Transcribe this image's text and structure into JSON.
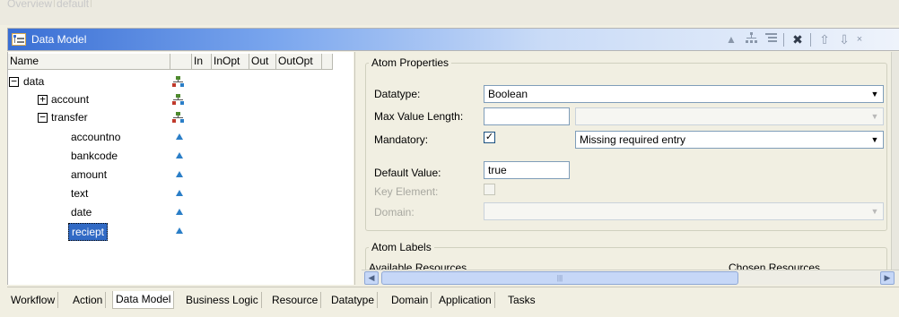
{
  "top_tabs": [
    "Overview",
    "default"
  ],
  "panel": {
    "title": "Data Model"
  },
  "toolbar": {
    "icons": [
      "up-triangle-icon",
      "tree-structure-icon",
      "list-indent-icon",
      "delete-icon",
      "arrow-up-icon",
      "arrow-down-icon",
      "close-icon"
    ]
  },
  "columns": [
    "Name",
    "In",
    "InOpt",
    "Out",
    "OutOpt"
  ],
  "tree": [
    {
      "label": "data",
      "expander": "−",
      "level": 0,
      "icon": "structure-icon"
    },
    {
      "label": "account",
      "expander": "+",
      "level": 1,
      "icon": "structure-icon"
    },
    {
      "label": "transfer",
      "expander": "−",
      "level": 1,
      "icon": "structure-icon"
    },
    {
      "label": "accountno",
      "level": 2,
      "icon": "atom-icon"
    },
    {
      "label": "bankcode",
      "level": 2,
      "icon": "atom-icon"
    },
    {
      "label": "amount",
      "level": 2,
      "icon": "atom-icon"
    },
    {
      "label": "text",
      "level": 2,
      "icon": "atom-icon"
    },
    {
      "label": "date",
      "level": 2,
      "icon": "atom-icon"
    },
    {
      "label": "reciept",
      "level": 2,
      "icon": "atom-icon",
      "selected": true
    }
  ],
  "atom_properties": {
    "title": "Atom Properties",
    "datatype": {
      "label": "Datatype:",
      "value": "Boolean"
    },
    "max_value_length": {
      "label": "Max Value Length:",
      "value": "",
      "unit_value": ""
    },
    "mandatory": {
      "label": "Mandatory:",
      "checked": true,
      "check_mark": "✓",
      "message": "Missing required entry"
    },
    "default_value": {
      "label": "Default Value:",
      "value": "true"
    },
    "key_element": {
      "label": "Key Element:",
      "checked": false
    },
    "domain": {
      "label": "Domain:",
      "value": ""
    }
  },
  "atom_labels": {
    "title": "Atom Labels",
    "available": "Available Resources",
    "chosen": "Chosen Resources"
  },
  "bottom_tabs": [
    "Workflow",
    "Action",
    "Data Model",
    "Business Logic",
    "Resource",
    "Datatype",
    "Domain",
    "Application",
    "Tasks"
  ],
  "active_bottom_tab": "Data Model",
  "colors": {
    "selection": "#316ac5",
    "title_gradient_start": "#3a6fd4",
    "atom_icon": "#2a7ec7"
  }
}
